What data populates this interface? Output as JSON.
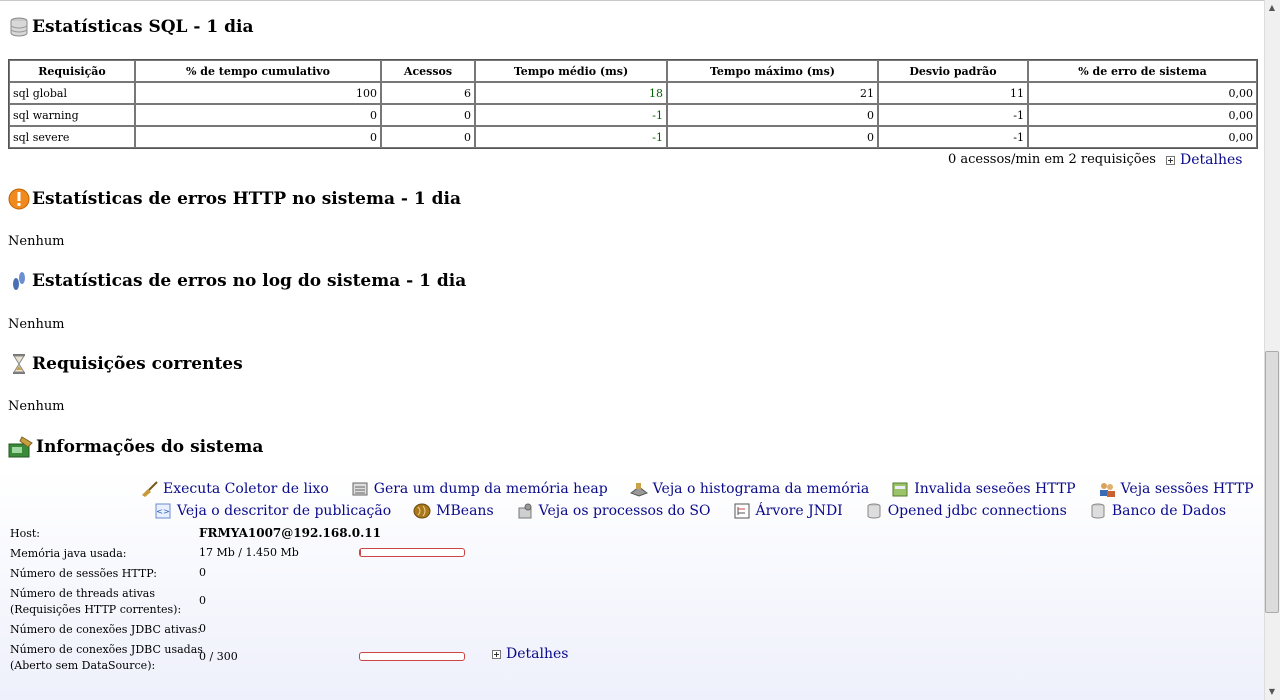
{
  "sql_section": {
    "title": "Estatísticas SQL - 1 dia",
    "columns": [
      "Requisição",
      "% de tempo cumulativo",
      "Acessos",
      "Tempo médio (ms)",
      "Tempo máximo (ms)",
      "Desvio padrão",
      "% de erro de sistema"
    ],
    "rows": [
      {
        "name": "sql global",
        "cumulative": "100",
        "hits": "6",
        "mean": "18",
        "max": "21",
        "stddev": "11",
        "errors": "0,00"
      },
      {
        "name": "sql warning",
        "cumulative": "0",
        "hits": "0",
        "mean": "-1",
        "max": "0",
        "stddev": "-1",
        "errors": "0,00"
      },
      {
        "name": "sql severe",
        "cumulative": "0",
        "hits": "0",
        "mean": "-1",
        "max": "0",
        "stddev": "-1",
        "errors": "0,00"
      }
    ],
    "summary": "0 acessos/min em 2 requisições",
    "details_label": "Detalhes",
    "icon": "database-icon"
  },
  "http_errors": {
    "title": "Estatísticas de erros HTTP no sistema - 1 dia",
    "value": "Nenhum",
    "icon": "warning-icon"
  },
  "log_errors": {
    "title": "Estatísticas de erros no log do sistema - 1 dia",
    "value": "Nenhum",
    "icon": "footprints-icon"
  },
  "current_requests": {
    "title": "Requisições correntes",
    "value": "Nenhum",
    "icon": "hourglass-icon"
  },
  "system_info": {
    "title": "Informações do sistema",
    "icon": "system-info-icon",
    "actions_row1": [
      {
        "label": "Executa Coletor de lixo",
        "icon": "broom-icon"
      },
      {
        "label": "Gera um dump da memória heap",
        "icon": "heap-dump-icon"
      },
      {
        "label": "Veja o histograma da memória",
        "icon": "memory-histogram-icon"
      },
      {
        "label": "Invalida seseões HTTP",
        "icon": "invalidate-sessions-icon"
      },
      {
        "label": "Veja sessões HTTP",
        "icon": "users-icon"
      }
    ],
    "actions_row2": [
      {
        "label": "Veja o descritor de publicação",
        "icon": "xml-descriptor-icon"
      },
      {
        "label": "MBeans",
        "icon": "beans-icon"
      },
      {
        "label": "Veja os processos do SO",
        "icon": "processes-icon"
      },
      {
        "label": "Árvore JNDI",
        "icon": "jndi-tree-icon"
      },
      {
        "label": "Opened jdbc connections",
        "icon": "database-icon"
      },
      {
        "label": "Banco de Dados",
        "icon": "database-icon"
      }
    ],
    "host_label": "Host:",
    "host_value": "FRMYA1007@192.168.0.11",
    "memory_label": "Memória java usada:",
    "memory_value": "17 Mb / 1.450 Mb",
    "memory_fraction": 0.012,
    "sessions_label": "Número de sessões HTTP:",
    "sessions_value": "0",
    "threads_label_1": "Número de threads ativas",
    "threads_label_2": "(Requisições HTTP correntes):",
    "threads_value": "0",
    "jdbc_active_label": "Número de conexões JDBC ativas:",
    "jdbc_active_value": "0",
    "jdbc_used_label_1": "Número de conexões JDBC usadas",
    "jdbc_used_label_2": "(Aberto sem DataSource):",
    "jdbc_used_value": "0 / 300",
    "jdbc_fraction": 0.0,
    "details_label": "Detalhes"
  },
  "colors": {
    "link": "#0a0a8a",
    "green_value": "#006400",
    "bar": "#cc4444"
  }
}
